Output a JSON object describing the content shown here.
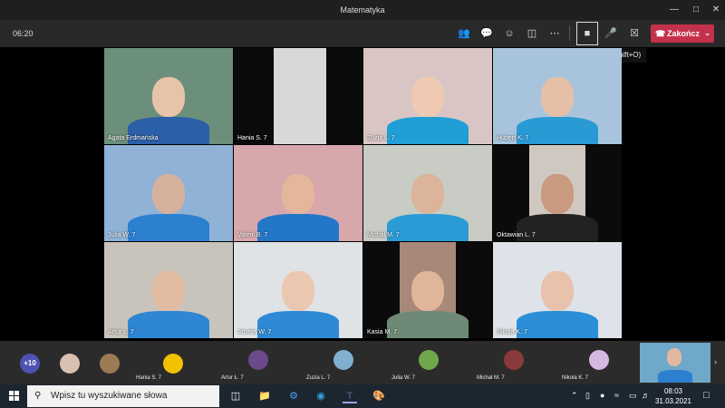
{
  "window": {
    "title": "Matematyka"
  },
  "toolbar": {
    "timer": "06:20",
    "leave_label": "Zakończ",
    "tooltip": "Wyłącz kamerę (Ctrl+Shift+O)"
  },
  "tiles": [
    {
      "name": "Agata Erdmańska"
    },
    {
      "name": "Hania S. 7"
    },
    {
      "name": "Zuzia L. 7"
    },
    {
      "name": "Hubert K. 7"
    },
    {
      "name": "Julia W. 7"
    },
    {
      "name": "Valerii B. 7"
    },
    {
      "name": "Michał M. 7"
    },
    {
      "name": "Oktawian L. 7"
    },
    {
      "name": "Artur Ł. 7"
    },
    {
      "name": "Amelia W. 7"
    },
    {
      "name": "Kasia M. 7"
    },
    {
      "name": "Nikola K. 7"
    }
  ],
  "strip": {
    "more": "+10",
    "participants": [
      {
        "name": "Hania S. 7"
      },
      {
        "name": "Artur Ł. 7"
      },
      {
        "name": "Zuzia L. 7"
      },
      {
        "name": "Julia W. 7"
      },
      {
        "name": "Michał M. 7"
      },
      {
        "name": "Nikola K. 7"
      }
    ]
  },
  "taskbar": {
    "search_placeholder": "Wpisz tu wyszukiwane słowa",
    "time": "08:03",
    "date": "31.03.2021"
  }
}
